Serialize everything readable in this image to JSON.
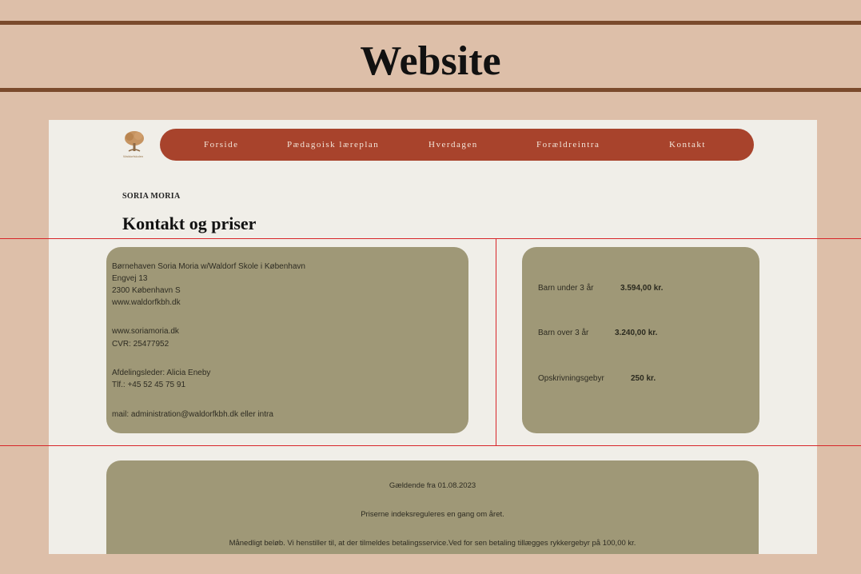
{
  "banner": {
    "title": "Website"
  },
  "site": {
    "logo": {
      "icon": "tree-logo-icon",
      "text": "Waldorfskolen"
    },
    "nav": [
      {
        "label": "Forside"
      },
      {
        "label": "Pædagoisk læreplan"
      },
      {
        "label": "Hverdagen"
      },
      {
        "label": "Forældreintra"
      },
      {
        "label": "Kontakt"
      }
    ],
    "kicker": "SORIA MORIA",
    "title": "Kontakt og priser"
  },
  "contact": {
    "lines": [
      "Børnehaven Soria Moria w/Waldorf Skole i København",
      "Engvej 13",
      "2300 København S",
      "www.waldorfkbh.dk",
      "www.soriamoria.dk",
      "CVR: 25477952",
      "Afdelingsleder: Alicia Eneby",
      "Tlf.: +45 52 45 75 91",
      "mail: administration@waldorfkbh.dk eller intra"
    ]
  },
  "prices": [
    {
      "label": "Barn under 3 år",
      "value": "3.594,00 kr."
    },
    {
      "label": "Barn over 3 år",
      "value": "3.240,00 kr."
    },
    {
      "label": "Opskrivningsgebyr",
      "value": "250 kr."
    }
  ],
  "notes": [
    "Gældende fra 01.08.2023",
    "Priserne indeksreguleres en gang om året.",
    "Månedligt beløb. Vi henstiller til, at der tilmeldes betalingsservice.Ved for sen betaling tillægges rykkergebyr på 100,00 kr."
  ],
  "colors": {
    "background": "#ddbfa9",
    "rule": "#7a4a2c",
    "nav": "#a8432c",
    "card": "#9f9877",
    "panel": "#f0eee8",
    "annotation": "#d8262a"
  }
}
